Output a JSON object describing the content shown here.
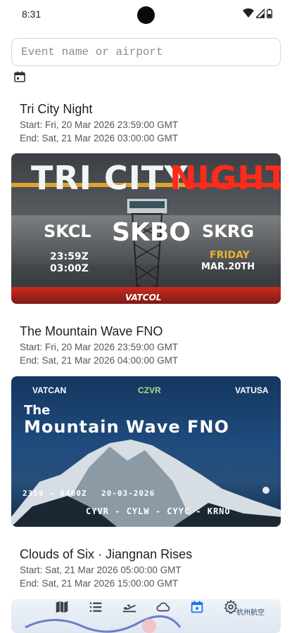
{
  "status": {
    "time": "8:31"
  },
  "search": {
    "placeholder": "Event name or airport"
  },
  "events": [
    {
      "title": "Tri City Night",
      "start": "Start: Fri, 20 Mar 2026 23:59:00 GMT",
      "end": "End: Sat, 21 Mar 2026 03:00:00 GMT",
      "banner": {
        "title_left": "TRI CITY",
        "title_right": "NIGHT",
        "airports": [
          "SKCL",
          "SKBO",
          "SKRG"
        ],
        "times": [
          "23:59Z",
          "03:00Z"
        ],
        "day": "FRIDAY",
        "date": "MAR.20TH",
        "org": "VATCOL"
      }
    },
    {
      "title": "The Mountain Wave FNO",
      "start": "Start: Fri, 20 Mar 2026 23:59:00 GMT",
      "end": "End: Sat, 21 Mar 2026 04:00:00 GMT",
      "banner": {
        "org_left": "VATCAN",
        "org_center": "CZVR",
        "org_right": "VATUSA",
        "line1": "The",
        "line2": "Mountain Wave FNO",
        "times": "2359 - 0400Z",
        "date": "20-03-2026",
        "airports": "CYVR - CYLW - CYYC - KRNO"
      }
    },
    {
      "title": "Clouds of Six · Jiangnan Rises",
      "start": "Start: Sat, 21 Mar 2026 05:00:00 GMT",
      "end": "End: Sat, 21 Mar 2026 15:00:00 GMT",
      "banner": {
        "logo_text": "杭州航空"
      }
    }
  ],
  "nav": [
    {
      "icon": "map-icon"
    },
    {
      "icon": "list-icon"
    },
    {
      "icon": "flight-takeoff-icon"
    },
    {
      "icon": "cloud-icon"
    },
    {
      "icon": "calendar-icon",
      "active": true
    },
    {
      "icon": "gear-icon"
    }
  ],
  "colors": {
    "accent": "#1a73e8",
    "red": "#ff2a1a",
    "gold": "#e0a22a"
  }
}
